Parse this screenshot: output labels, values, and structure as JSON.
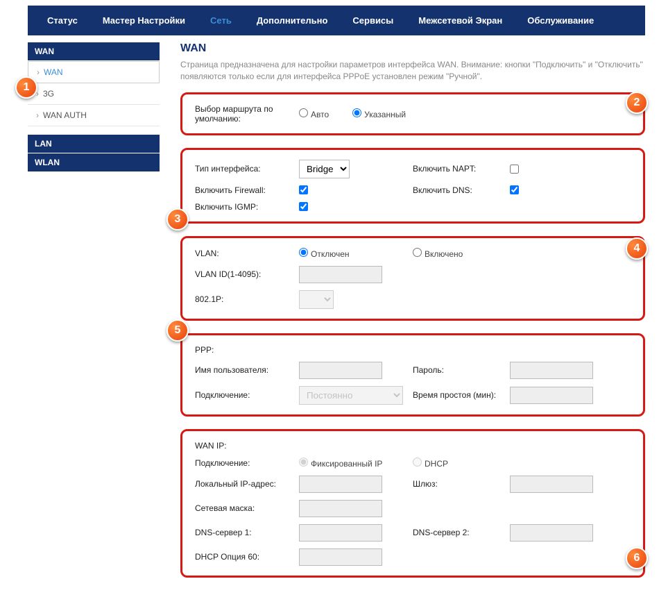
{
  "nav": {
    "status": "Статус",
    "wizard": "Мастер Настройки",
    "network": "Сеть",
    "advanced": "Дополнительно",
    "services": "Сервисы",
    "firewall": "Межсетевой Экран",
    "maintenance": "Обслуживание"
  },
  "sidebar": {
    "wan_header": "WAN",
    "wan": "WAN",
    "g3": "3G",
    "wan_auth": "WAN AUTH",
    "lan_header": "LAN",
    "wlan_header": "WLAN"
  },
  "page": {
    "title": "WAN",
    "desc": "Страница предназначена для настройки параметров интерфейса WAN. Внимание: кнопки \"Подключить\" и \"Отключить\" появляются только если для интерфейса PPPoE установлен режим \"Ручной\"."
  },
  "s1": {
    "route_label": "Выбор маршрута по умолчанию:",
    "auto": "Авто",
    "specified": "Указанный"
  },
  "s2": {
    "iface_type": "Тип интерфейса:",
    "iface_value": "Bridge",
    "napt": "Включить NAPT:",
    "firewall": "Включить Firewall:",
    "dns": "Включить DNS:",
    "igmp": "Включить IGMP:"
  },
  "s3": {
    "vlan": "VLAN:",
    "off": "Отключен",
    "on": "Включено",
    "vlan_id": "VLAN ID(1-4095):",
    "p8021": "802.1P:"
  },
  "s4": {
    "ppp": "PPP:",
    "user": "Имя пользователя:",
    "pass": "Пароль:",
    "conn": "Подключение:",
    "conn_val": "Постоянно",
    "idle": "Время простоя (мин):"
  },
  "s5": {
    "wan_ip": "WAN IP:",
    "conn": "Подключение:",
    "fixed": "Фиксированный IP",
    "dhcp": "DHCP",
    "local_ip": "Локальный IP-адрес:",
    "gateway": "Шлюз:",
    "mask": "Сетевая маска:",
    "dns1": "DNS-сервер 1:",
    "dns2": "DNS-сервер 2:",
    "opt60": "DHCP Опция 60:"
  },
  "callouts": [
    "1",
    "2",
    "3",
    "4",
    "5",
    "6"
  ]
}
